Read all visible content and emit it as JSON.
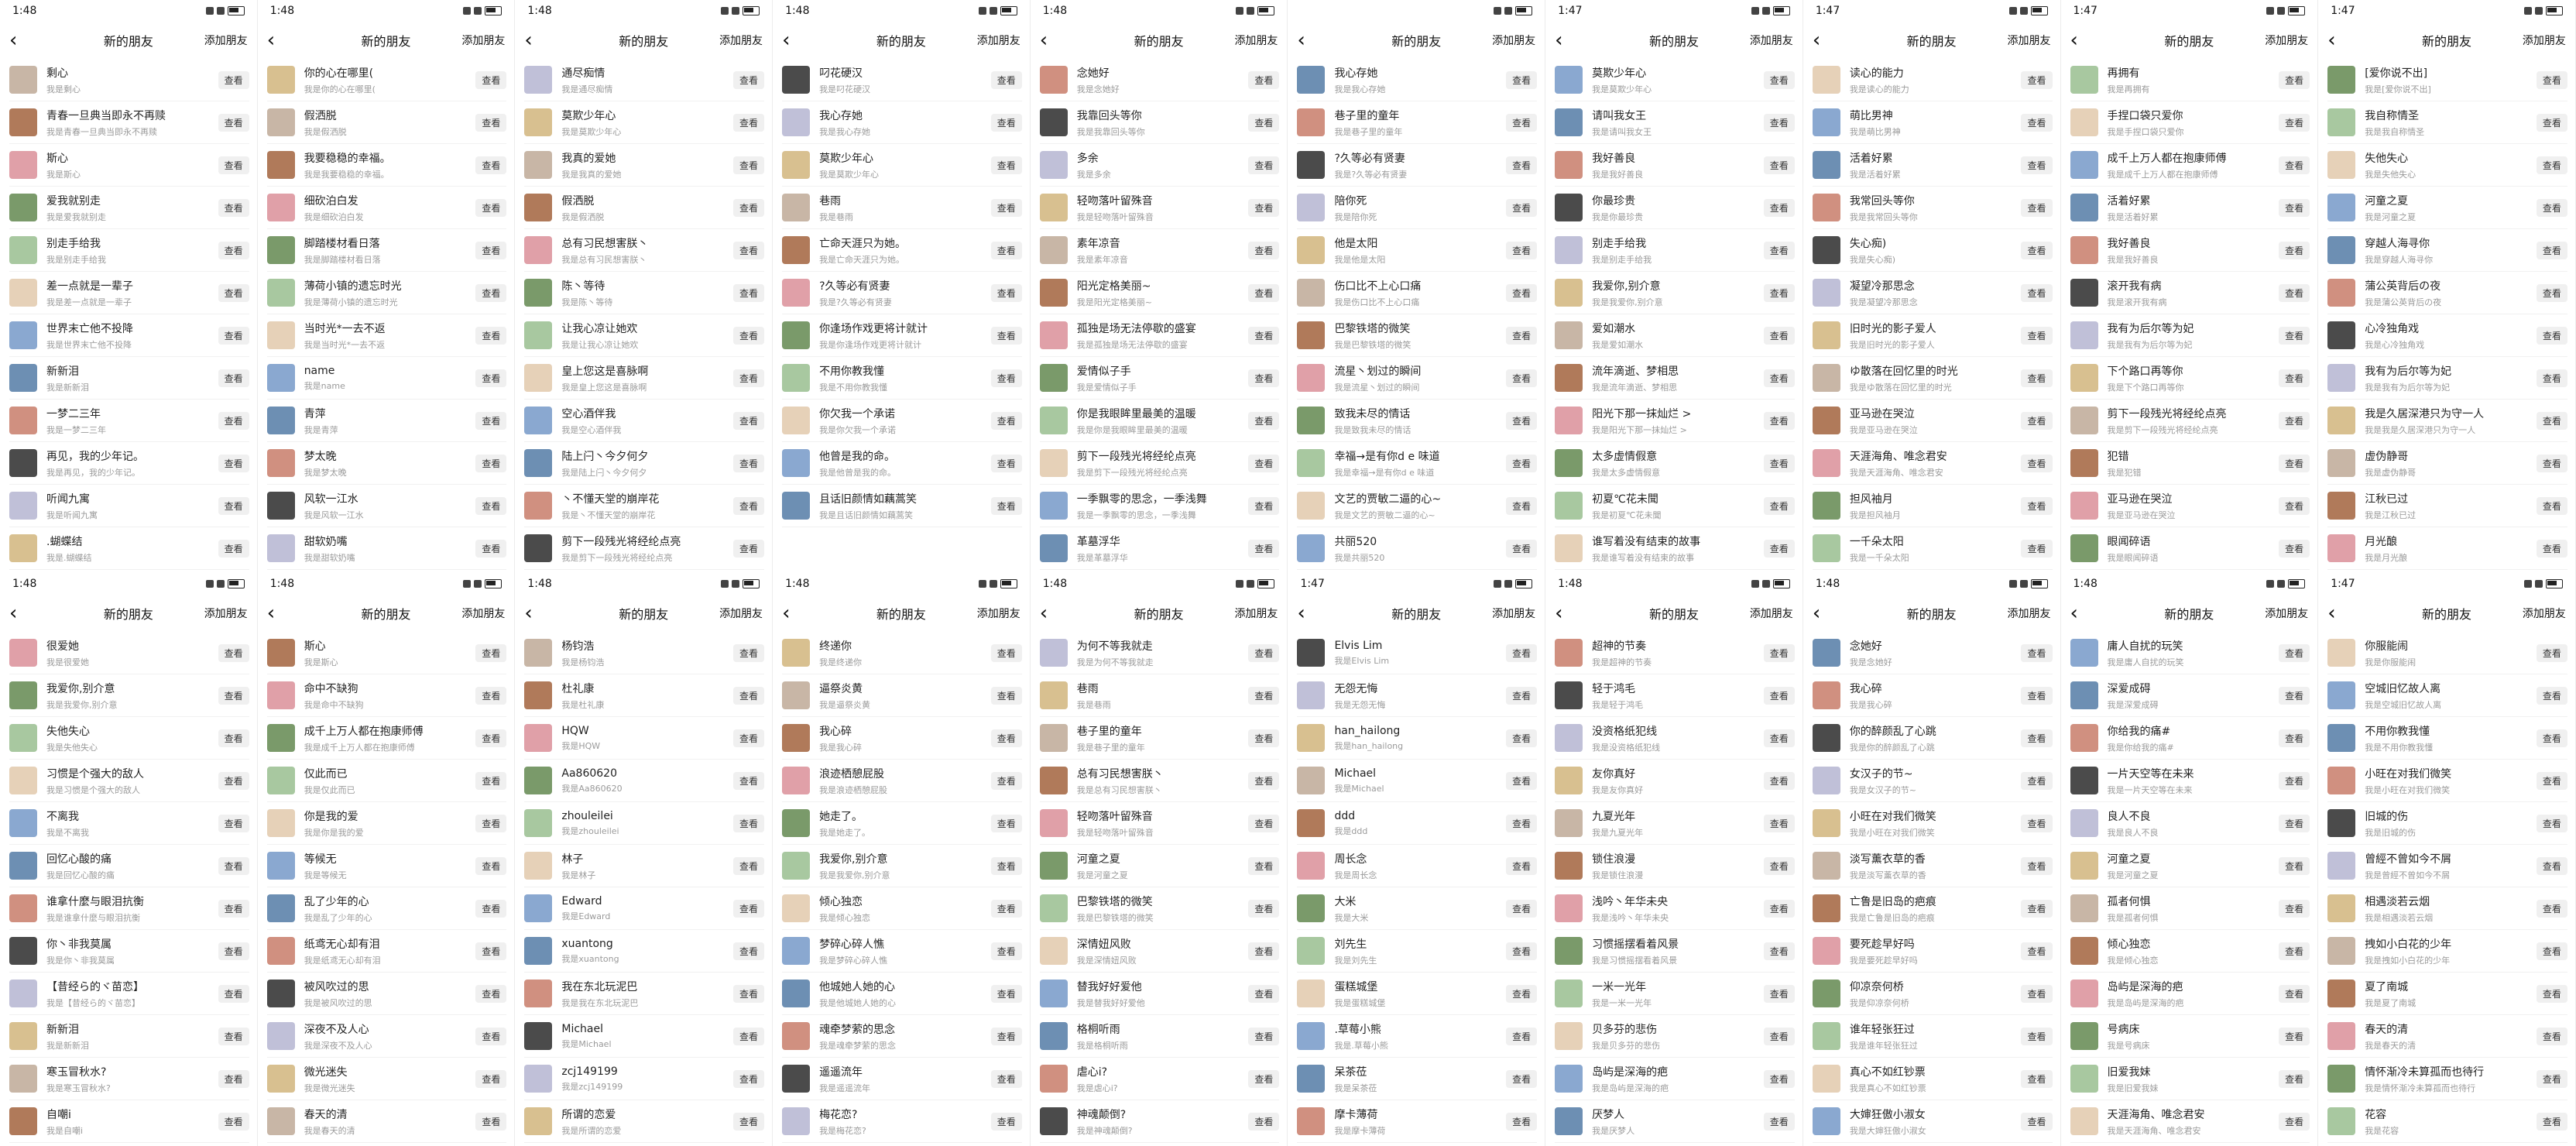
{
  "ui": {
    "title": "新的朋友",
    "add": "添加朋友",
    "view": "查看"
  },
  "colors": [
    "#c8b6a6",
    "#6d8fb3",
    "#e0a0a8",
    "#4b4b4b",
    "#a8c8a0",
    "#d8c090",
    "#8aa8d0",
    "#b07a5a",
    "#d09080",
    "#7a9a6a",
    "#c0c0d8",
    "#e6d1b8"
  ],
  "panels": [
    {
      "time": "1:48",
      "rows": [
        [
          "剩心",
          "我是剩心"
        ],
        [
          "青春一旦典当即永不再赎",
          "我是青春一旦典当即永不再赎"
        ],
        [
          "斯心",
          "我是斯心"
        ],
        [
          "爱我就别走",
          "我是爱我就别走"
        ],
        [
          "别走手给我",
          "我是别走手给我"
        ],
        [
          "差一点就是一辈子",
          "我是差一点就是一辈子"
        ],
        [
          "世界末亡他不投降",
          "我是世界末亡他不投降"
        ],
        [
          "新新泪",
          "我是新新泪"
        ],
        [
          "一梦二三年",
          "我是一梦二三年"
        ],
        [
          "再见，我的少年记。",
          "我是再见，我的少年记。"
        ],
        [
          "听闻九寓",
          "我是听闻九寓"
        ],
        [
          ".蝴蝶结",
          "我是.蝴蝶结"
        ]
      ]
    },
    {
      "time": "1:48",
      "rows": [
        [
          "你的心在哪里(",
          "我是你的心在哪里("
        ],
        [
          "假洒脱",
          "我是假洒脱"
        ],
        [
          "我要稳稳的幸福。",
          "我是我要稳稳的幸福。"
        ],
        [
          "细砍泊白发",
          "我是细砍泊白发"
        ],
        [
          "脚踏楼材看日落",
          "我是脚踏楼材看日落"
        ],
        [
          "薄荷小镇的遗忘时光",
          "我是薄荷小镇的遗忘时光"
        ],
        [
          "当时光*一去不返",
          "我是当时光*一去不返"
        ],
        [
          "name",
          "我是name"
        ],
        [
          "青萍",
          "我是青萍"
        ],
        [
          "梦太晚",
          "我是梦太晚"
        ],
        [
          "风软一江水",
          "我是风软一江水"
        ],
        [
          "甜软奶嘴",
          "我是甜软奶嘴"
        ]
      ]
    },
    {
      "time": "1:48",
      "rows": [
        [
          "通尽痴情",
          "我是通尽痴情"
        ],
        [
          "莫欺少年心",
          "我是莫欺少年心"
        ],
        [
          "我真的爱她",
          "我是我真的爱她"
        ],
        [
          "假洒脱",
          "我是假洒脱"
        ],
        [
          "总有习民想害朕丶",
          "我是总有习民想害朕丶"
        ],
        [
          "陈丶等待",
          "我是陈丶等待"
        ],
        [
          "让我心凉让她欢",
          "我是让我心凉让她欢"
        ],
        [
          "皇上您这是喜脉啊",
          "我是皇上您这是喜脉啊"
        ],
        [
          "空心酒伴我",
          "我是空心酒伴我"
        ],
        [
          "陆上闩丶今夕何夕",
          "我是陆上闩丶今夕何夕"
        ],
        [
          "丶不懂天堂的崩岸花",
          "我是丶不懂天堂的崩岸花"
        ],
        [
          "剪下一段残光将经纶点亮",
          "我是剪下一段残光将经纶点亮"
        ]
      ]
    },
    {
      "time": "1:48",
      "rows": [
        [
          "叼花硬汉",
          "我是叼花硬汉"
        ],
        [
          "我心存她",
          "我是我心存她"
        ],
        [
          "莫欺少年心",
          "我是莫欺少年心"
        ],
        [
          "巷雨",
          "我是巷雨"
        ],
        [
          "亡命天涯只为她。",
          "我是亡命天涯只为她。"
        ],
        [
          "?久等必有贤妻",
          "我是?久等必有贤妻"
        ],
        [
          "你逢场作戏更将计就计",
          "我是你逢场作戏更将计就计"
        ],
        [
          "不用你教我懂",
          "我是不用你教我懂"
        ],
        [
          "你欠我一个承诺",
          "我是你欠我一个承诺"
        ],
        [
          "他曾是我的命。",
          "我是他曾是我的命。"
        ],
        [
          "且话旧颜情如藕蒿笑",
          "我是且话旧颜情如藕蒿笑"
        ]
      ]
    },
    {
      "time": "1:48",
      "rows": [
        [
          "念她好",
          "我是念她好"
        ],
        [
          "我靠回头等你",
          "我是我靠回头等你"
        ],
        [
          "多余",
          "我是多余"
        ],
        [
          "轻吻落叶留殊音",
          "我是轻吻落叶留殊音"
        ],
        [
          "素年凉音",
          "我是素年凉音"
        ],
        [
          "阳光定格美丽~",
          "我是阳光定格美丽~"
        ],
        [
          "孤独是场无法停歇的盛宴",
          "我是孤独是场无法停歇的盛宴"
        ],
        [
          "爱情似子手",
          "我是爱情似子手"
        ],
        [
          "你是我眼眸里最美的温暖",
          "我是你是我眼眸里最美的温暖"
        ],
        [
          "剪下一段残光将经纶点亮",
          "我是剪下一段残光将经纶点亮"
        ],
        [
          "一季飘零的思念，一季浅舞",
          "我是一季飘零的思念，一季浅舞"
        ],
        [
          "革墓浮华",
          "我是革墓浮华"
        ]
      ]
    },
    {
      "time": "",
      "rows": [
        [
          "我心存她",
          "我是我心存她"
        ],
        [
          "巷子里的童年",
          "我是巷子里的童年"
        ],
        [
          "?久等必有贤妻",
          "我是?久等必有贤妻"
        ],
        [
          "陪你死",
          "我是陪你死"
        ],
        [
          "他是太阳",
          "我是他是太阳"
        ],
        [
          "伤口比不上心口痛",
          "我是伤口比不上心口痛"
        ],
        [
          "巴黎铁塔的微笑",
          "我是巴黎铁塔的微笑"
        ],
        [
          "流星丶划过的瞬间",
          "我是流星丶划过的瞬间"
        ],
        [
          "致我未尽的情话",
          "我是致我未尽的情话"
        ],
        [
          "幸福→是有你d e 味道",
          "我是幸福→是有你d e 味道"
        ],
        [
          "文艺的贾敏二逼的心~",
          "我是文艺的贾敏二逼的心~"
        ],
        [
          "共丽520",
          "我是共丽520"
        ]
      ]
    },
    {
      "time": "1:47",
      "rows": [
        [
          "莫欺少年心",
          "我是莫欺少年心"
        ],
        [
          "请叫我女王",
          "我是请叫我女王"
        ],
        [
          "我好善良",
          "我是我好善良"
        ],
        [
          "你最珍贵",
          "我是你最珍贵"
        ],
        [
          "别走手给我",
          "我是别走手给我"
        ],
        [
          "我爱你,别介意",
          "我是我爱你,别介意"
        ],
        [
          "爱如潮水",
          "我是爱如潮水"
        ],
        [
          "流年滴逝、梦相思",
          "我是流年滴逝、梦相思"
        ],
        [
          "阳光下那一抹灿烂 >",
          "我是阳光下那一抹灿烂 >"
        ],
        [
          "太多虚情假意",
          "我是太多虚情假意"
        ],
        [
          "初夏℃花未聞",
          "我是初夏℃花未聞"
        ],
        [
          "谁写着没有结束的故事",
          "我是谁写着没有结束的故事"
        ]
      ]
    },
    {
      "time": "1:47",
      "rows": [
        [
          "读心的能力",
          "我是读心的能力"
        ],
        [
          "萌比男神",
          "我是萌比男神"
        ],
        [
          "活着好累",
          "我是活着好累"
        ],
        [
          "我常回头等你",
          "我是我常回头等你"
        ],
        [
          "失心痴)",
          "我是失心痴)"
        ],
        [
          "凝望冷那思念",
          "我是凝望冷那思念"
        ],
        [
          "旧时光的影子爱人",
          "我是旧时光的影子爱人"
        ],
        [
          "ゆ散落在回忆里的时光",
          "我是ゆ散落在回忆里的时光"
        ],
        [
          "亚马逊在哭泣",
          "我是亚马逊在哭泣"
        ],
        [
          "天涯海角、唯念君安",
          "我是天涯海角、唯念君安"
        ],
        [
          "担风袖月",
          "我是担风袖月"
        ],
        [
          "一千朵太阳",
          "我是一千朵太阳"
        ]
      ]
    },
    {
      "time": "1:47",
      "rows": [
        [
          "再拥有",
          "我是再拥有"
        ],
        [
          "手捏口袋只爱你",
          "我是手捏口袋只爱你"
        ],
        [
          "成千上万人都在抱康师傅",
          "我是成千上万人都在抱康师傅"
        ],
        [
          "活着好累",
          "我是活着好累"
        ],
        [
          "我好善良",
          "我是我好善良"
        ],
        [
          "滚开我有病",
          "我是滚开我有病"
        ],
        [
          "我有为后尔等为妃",
          "我是我有为后尔等为妃"
        ],
        [
          "下个路口再等你",
          "我是下个路口再等你"
        ],
        [
          "剪下一段残光将经纶点亮",
          "我是剪下一段残光将经纶点亮"
        ],
        [
          "犯错",
          "我是犯错"
        ],
        [
          "亚马逊在哭泣",
          "我是亚马逊在哭泣"
        ],
        [
          "眼闻碎语",
          "我是眼闻碎语"
        ]
      ]
    },
    {
      "time": "1:47",
      "rows": [
        [
          "[爱你说不出]",
          "我是[爱你说不出]"
        ],
        [
          "我自称情圣",
          "我是我自称情圣"
        ],
        [
          "失他失心",
          "我是失他失心"
        ],
        [
          "河童之夏",
          "我是河童之夏"
        ],
        [
          "穿越人海寻你",
          "我是穿越人海寻你"
        ],
        [
          "蒲公英背后の夜",
          "我是蒲公英背后の夜"
        ],
        [
          "心冷独角戏",
          "我是心冷独角戏"
        ],
        [
          "我有为后尔等为妃",
          "我是我有为后尔等为妃"
        ],
        [
          "我是久居深港只为守一人",
          "我是我是久居深港只为守一人"
        ],
        [
          "虚伪静哥",
          "我是虚伪静哥"
        ],
        [
          "江秋已过",
          "我是江秋已过"
        ],
        [
          "月光酿",
          "我是月光酿"
        ]
      ]
    },
    {
      "time": "1:48",
      "rows": [
        [
          "很爱她",
          "我是很爱她"
        ],
        [
          "我爱你,别介意",
          "我是我爱你,别介意"
        ],
        [
          "失他失心",
          "我是失他失心"
        ],
        [
          "习惯是个强大的敌人",
          "我是习惯是个强大的敌人"
        ],
        [
          "不离我",
          "我是不离我"
        ],
        [
          "回忆心酸的痛",
          "我是回忆心酸的痛"
        ],
        [
          "谁拿什麼与眼泪抗衡",
          "我是谁拿什麼与眼泪抗衡"
        ],
        [
          "你丶非我莫属",
          "我是你丶非我莫属"
        ],
        [
          "【昔经ら的ヾ苗恋】",
          "我是【昔经ら的ヾ苗恋】"
        ],
        [
          "新新泪",
          "我是新新泪"
        ],
        [
          "寒玉冒秋水?",
          "我是寒玉冒秋水?"
        ],
        [
          "自嘲i",
          "我是自嘲i"
        ]
      ]
    },
    {
      "time": "1:48",
      "rows": [
        [
          "斯心",
          "我是斯心"
        ],
        [
          "命中不缺狗",
          "我是命中不缺狗"
        ],
        [
          "成千上万人都在抱康师傅",
          "我是成千上万人都在抱康师傅"
        ],
        [
          "仅此而已",
          "我是仅此而已"
        ],
        [
          "你是我的爱",
          "我是你是我的爱"
        ],
        [
          "等候无",
          "我是等候无"
        ],
        [
          "乱了少年的心",
          "我是乱了少年的心"
        ],
        [
          "纸鸢无心却有泪",
          "我是纸鸢无心却有泪"
        ],
        [
          "被风吹过的思",
          "我是被风吹过的思"
        ],
        [
          "深夜不及人心",
          "我是深夜不及人心"
        ],
        [
          "微光迷失",
          "我是微光迷失"
        ],
        [
          "春天的清",
          "我是春天的清"
        ]
      ]
    },
    {
      "time": "1:48",
      "rows": [
        [
          "杨钧浩",
          "我是杨钧浩"
        ],
        [
          "杜礼康",
          "我是杜礼康"
        ],
        [
          "HQW",
          "我是HQW"
        ],
        [
          "Aa860620",
          "我是Aa860620"
        ],
        [
          "zhouleilei",
          "我是zhouleilei"
        ],
        [
          "林子",
          "我是林子"
        ],
        [
          "Edward",
          "我是Edward"
        ],
        [
          "xuantong",
          "我是xuantong"
        ],
        [
          "我在东北玩泥巴",
          "我是我在东北玩泥巴"
        ],
        [
          "Michael",
          "我是Michael"
        ],
        [
          "zcj149199",
          "我是zcj149199"
        ],
        [
          "所谓的恋爱",
          "我是所谓的恋爱"
        ]
      ]
    },
    {
      "time": "1:48",
      "rows": [
        [
          "终递你",
          "我是终递你"
        ],
        [
          "逼祭炎黄",
          "我是逼祭炎黄"
        ],
        [
          "我心碎",
          "我是我心碎"
        ],
        [
          "浪迹栖憩屁股",
          "我是浪迹栖憩屁股"
        ],
        [
          "她走了。",
          "我是她走了。"
        ],
        [
          "我爱你,别介意",
          "我是我爱你,别介意"
        ],
        [
          "倾心独恋",
          "我是倾心独恋"
        ],
        [
          "梦碎心碎人憔",
          "我是梦碎心碎人憔"
        ],
        [
          "他城她人她的心",
          "我是他城她人她的心"
        ],
        [
          "魂牵梦萦的思念",
          "我是魂牵梦萦的思念"
        ],
        [
          "遥遥流年",
          "我是遥遥流年"
        ],
        [
          "梅花恋?",
          "我是梅花恋?"
        ]
      ]
    },
    {
      "time": "1:48",
      "rows": [
        [
          "为何不等我就走",
          "我是为何不等我就走"
        ],
        [
          "巷雨",
          "我是巷雨"
        ],
        [
          "巷子里的童年",
          "我是巷子里的童年"
        ],
        [
          "总有习民想害朕丶",
          "我是总有习民想害朕丶"
        ],
        [
          "轻吻落叶留殊音",
          "我是轻吻落叶留殊音"
        ],
        [
          "河童之夏",
          "我是河童之夏"
        ],
        [
          "巴黎铁塔的微笑",
          "我是巴黎铁塔的微笑"
        ],
        [
          "深情妞风败",
          "我是深情妞风败"
        ],
        [
          "替我好好爱他",
          "我是替我好好爱他"
        ],
        [
          "格桐听雨",
          "我是格桐听雨"
        ],
        [
          "虐心i?",
          "我是虐心i?"
        ],
        [
          "神魂颠倒?",
          "我是神魂颠倒?"
        ]
      ]
    },
    {
      "time": "1:47",
      "rows": [
        [
          "Elvis Lim",
          "我是Elvis Lim"
        ],
        [
          "无怨无悔",
          "我是无怨无悔"
        ],
        [
          "han_hailong",
          "我是han_hailong"
        ],
        [
          "Michael",
          "我是Michael"
        ],
        [
          "ddd",
          "我是ddd"
        ],
        [
          "周长念",
          "我是周长念"
        ],
        [
          "大米",
          "我是大米"
        ],
        [
          "刘先生",
          "我是刘先生"
        ],
        [
          "蛋糕城堡",
          "我是蛋糕城堡"
        ],
        [
          ".草莓小熊",
          "我是.草莓小熊"
        ],
        [
          "呆茶莅",
          "我是呆茶莅"
        ],
        [
          "摩卡薄荷",
          "我是摩卡薄荷"
        ]
      ]
    },
    {
      "time": "1:48",
      "rows": [
        [
          "超神的节奏",
          "我是超神的节奏"
        ],
        [
          "轻于鸿毛",
          "我是轻于鸿毛"
        ],
        [
          "没资格纸犯线",
          "我是没资格纸犯线"
        ],
        [
          "友你真好",
          "我是友你真好"
        ],
        [
          "九夏光年",
          "我是九夏光年"
        ],
        [
          "锁住浪漫",
          "我是锁住浪漫"
        ],
        [
          "浅吟丶年华未央",
          "我是浅吟丶年华未央"
        ],
        [
          "习惯摇摆看着风景",
          "我是习惯摇摆看着风景"
        ],
        [
          "一米一光年",
          "我是一米一光年"
        ],
        [
          "贝多芬的悲伤",
          "我是贝多芬的悲伤"
        ],
        [
          "岛屿是深海的疤",
          "我是岛屿是深海的疤"
        ],
        [
          "厌梦人",
          "我是厌梦人"
        ]
      ]
    },
    {
      "time": "1:48",
      "rows": [
        [
          "念她好",
          "我是念她好"
        ],
        [
          "我心碎",
          "我是我心碎"
        ],
        [
          "你的醉颜乱了心跳",
          "我是你的醉颜乱了心跳"
        ],
        [
          "女汉子的节~",
          "我是女汉子的节~"
        ],
        [
          "小旺在对我们微笑",
          "我是小旺在对我们微笑"
        ],
        [
          "淡写薰衣草的香",
          "我是淡写薰衣草的香"
        ],
        [
          "亡鲁是旧岛的疤痕",
          "我是亡鲁是旧岛的疤痕"
        ],
        [
          "要死趁早好吗",
          "我是要死趁早好吗"
        ],
        [
          "仰凉奈何桥",
          "我是仰凉奈何桥"
        ],
        [
          "谁年轻张狂过",
          "我是谁年轻张狂过"
        ],
        [
          "真心不如红钞票",
          "我是真心不如红钞票"
        ],
        [
          "大婶狂傲小淑女",
          "我是大婶狂傲小淑女"
        ]
      ]
    },
    {
      "time": "1:48",
      "rows": [
        [
          "庸人自扰的玩笑",
          "我是庸人自扰的玩笑"
        ],
        [
          "深爱成碍",
          "我是深爱成碍"
        ],
        [
          "你给我的痛#",
          "我是你给我的痛#"
        ],
        [
          "一片天空等在未来",
          "我是一片天空等在未来"
        ],
        [
          "良人不良",
          "我是良人不良"
        ],
        [
          "河童之夏",
          "我是河童之夏"
        ],
        [
          "孤者何惧",
          "我是孤者何惧"
        ],
        [
          "倾心独恋",
          "我是倾心独恋"
        ],
        [
          "岛屿是深海的疤",
          "我是岛屿是深海的疤"
        ],
        [
          "号病床",
          "我是号病床"
        ],
        [
          "旧爱我妹",
          "我是旧爱我妹"
        ],
        [
          "天涯海角、唯念君安",
          "我是天涯海角、唯念君安"
        ]
      ]
    },
    {
      "time": "1:47",
      "rows": [
        [
          "你服能闹",
          "我是你服能闹"
        ],
        [
          "空城旧忆故人离",
          "我是空城旧忆故人离"
        ],
        [
          "不用你教我懂",
          "我是不用你教我懂"
        ],
        [
          "小旺在对我们微笑",
          "我是小旺在对我们微笑"
        ],
        [
          "旧城的伤",
          "我是旧城的伤"
        ],
        [
          "曾經不曾如今不屑",
          "我是曾經不曾如今不屑"
        ],
        [
          "相遇淡若云烟",
          "我是相遇淡若云烟"
        ],
        [
          "拽如小白花的少年",
          "我是拽如小白花的少年"
        ],
        [
          "夏了南城",
          "我是夏了南城"
        ],
        [
          "春天的清",
          "我是春天的清"
        ],
        [
          "情怀渐冷未算孤而也待行",
          "我是情怀渐冷未算孤而也待行"
        ],
        [
          "花容",
          "我是花容"
        ]
      ]
    }
  ]
}
